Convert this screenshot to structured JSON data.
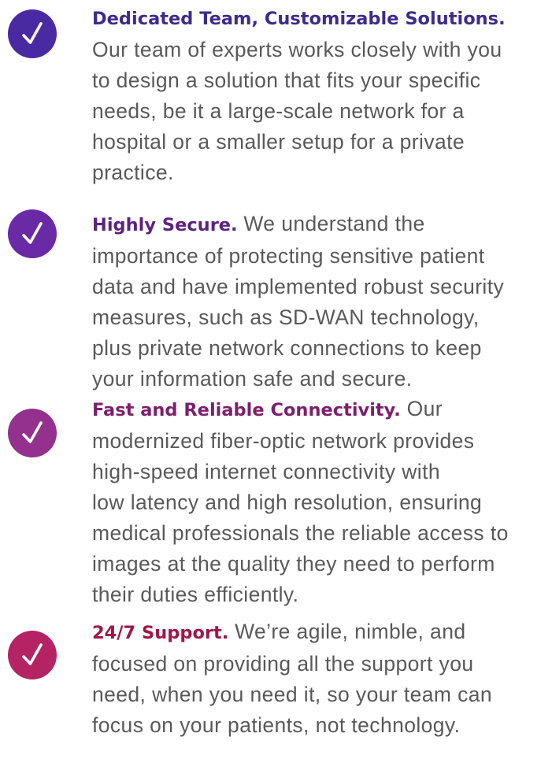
{
  "features": [
    {
      "title": "Dedicated Team, Customizable Solutions.",
      "title_color": "#3d2c8d",
      "badge_color": "#4a2aa3",
      "icon": "checkmark-icon",
      "body_lines": [
        "Our team of experts works closely with you",
        "to design a solution that fits your specific",
        "needs, be it a large-scale network for a",
        "hospital or a smaller setup for a private",
        "practice."
      ]
    },
    {
      "title": "Highly Secure.",
      "title_color": "#5b237f",
      "badge_color": "#6a2aa6",
      "icon": "checkmark-icon",
      "first_line_rest": " We understand the",
      "body_lines": [
        "importance of protecting sensitive patient",
        "data and have implemented robust security",
        "measures, such as SD-WAN technology,",
        "plus private network connections to keep",
        "your information safe and secure."
      ]
    },
    {
      "title": "Fast and Reliable Connectivity.",
      "title_color": "#7d1f6b",
      "badge_color": "#94308e",
      "icon": "checkmark-icon",
      "first_line_rest": " Our",
      "body_lines": [
        "modernized fiber-optic network provides",
        "high-speed internet connectivity with",
        "low latency and high resolution, ensuring",
        "medical professionals the reliable access to",
        "images at the quality they need to perform",
        "their duties efficiently."
      ]
    },
    {
      "title": "24/7 Support.",
      "title_color": "#a0174a",
      "badge_color": "#b42364",
      "icon": "checkmark-icon",
      "first_line_rest": " We’re agile, nimble, and",
      "body_lines": [
        "focused on providing all the support you",
        "need, when you need it, so your team can",
        "focus on your patients, not technology."
      ]
    }
  ]
}
